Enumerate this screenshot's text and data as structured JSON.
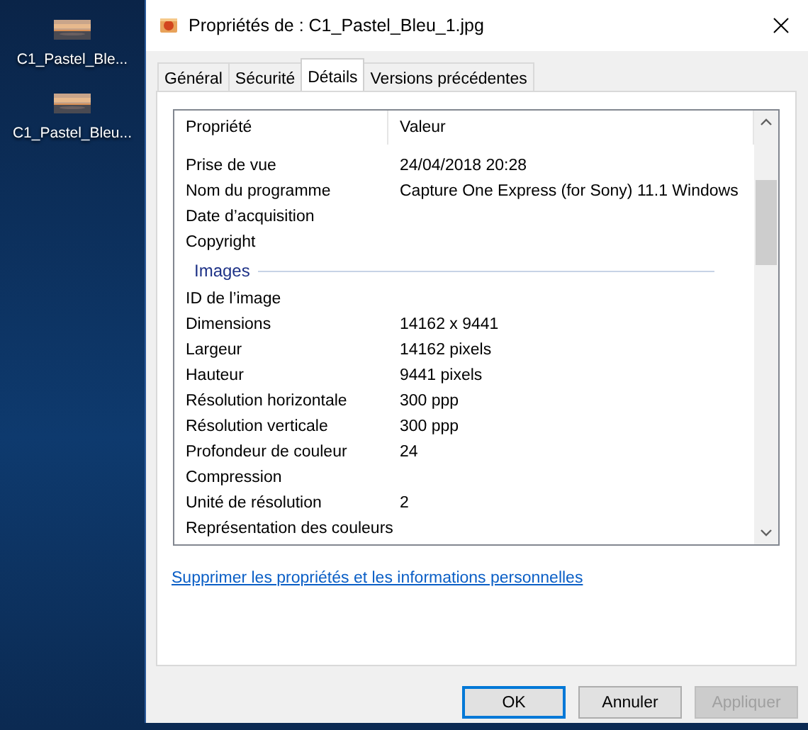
{
  "desktop": {
    "icons": [
      {
        "label": "C1_Pastel_Ble..."
      },
      {
        "label": "C1_Pastel_Bleu..."
      }
    ]
  },
  "dialog": {
    "title": "Propriétés de : C1_Pastel_Bleu_1.jpg",
    "tabs": [
      {
        "label": "Général",
        "selected": false
      },
      {
        "label": "Sécurité",
        "selected": false
      },
      {
        "label": "Détails",
        "selected": true
      },
      {
        "label": "Versions précédentes",
        "selected": false
      }
    ],
    "table": {
      "columns": [
        "Propriété",
        "Valeur"
      ],
      "rows": [
        {
          "kind": "row",
          "name": "Prise de vue",
          "value": "24/04/2018 20:28"
        },
        {
          "kind": "row",
          "name": "Nom du programme",
          "value": "Capture One Express (for Sony) 11.1 Windows"
        },
        {
          "kind": "row",
          "name": "Date d’acquisition"
        },
        {
          "kind": "row",
          "name": "Copyright"
        },
        {
          "kind": "group",
          "name": "Images"
        },
        {
          "kind": "row",
          "name": "ID de l’image"
        },
        {
          "kind": "row",
          "name": "Dimensions",
          "value": "14162 x 9441"
        },
        {
          "kind": "row",
          "name": "Largeur",
          "value": "14162 pixels"
        },
        {
          "kind": "row",
          "name": "Hauteur",
          "value": "9441 pixels"
        },
        {
          "kind": "row",
          "name": "Résolution horizontale",
          "value": "300 ppp"
        },
        {
          "kind": "row",
          "name": "Résolution verticale",
          "value": "300 ppp"
        },
        {
          "kind": "row",
          "name": "Profondeur de couleur",
          "value": "24"
        },
        {
          "kind": "row",
          "name": "Compression"
        },
        {
          "kind": "row",
          "name": "Unité de résolution",
          "value": "2"
        },
        {
          "kind": "row",
          "name": "Représentation des couleurs"
        }
      ]
    },
    "link": "Supprimer les propriétés et les informations personnelles",
    "buttons": [
      {
        "label": "OK",
        "default": true,
        "disabled": false
      },
      {
        "label": "Annuler",
        "default": false,
        "disabled": false
      },
      {
        "label": "Appliquer",
        "default": false,
        "disabled": true
      }
    ]
  }
}
